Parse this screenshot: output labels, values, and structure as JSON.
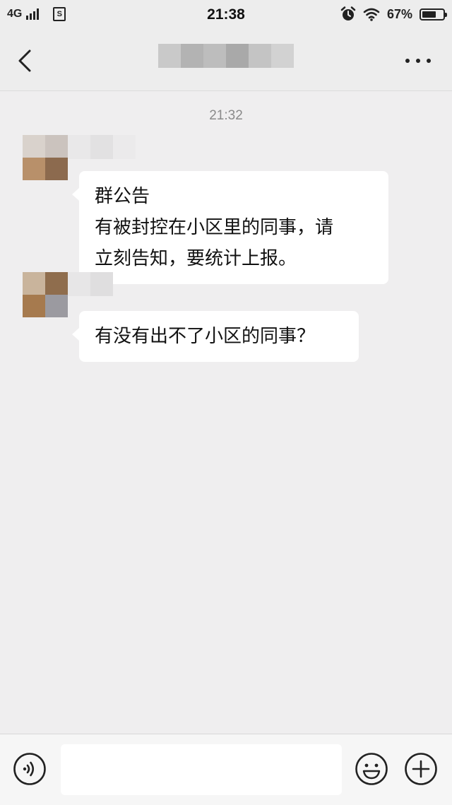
{
  "status_bar": {
    "network": "4G",
    "sim_label": "S",
    "time": "21:38",
    "battery_percent": "67%",
    "battery_level": 0.67,
    "icons": [
      "signal-icon",
      "sim-icon",
      "alarm-icon",
      "wifi-icon",
      "battery-icon"
    ]
  },
  "nav": {
    "back_icon": "chevron-left-icon",
    "title_blurred": true,
    "more_icon": "more-dots-icon"
  },
  "chat": {
    "timestamp": "21:32",
    "messages": [
      {
        "sender_blurred": true,
        "lines": [
          "群公告",
          "有被封控在小区里的同事，请",
          "立刻告知，要统计上报。"
        ]
      },
      {
        "sender_blurred": true,
        "lines": [
          "有没有出不了小区的同事？"
        ]
      }
    ]
  },
  "input_bar": {
    "voice_icon": "voice-icon",
    "input_value": "",
    "emoji_icon": "emoji-icon",
    "plus_icon": "plus-icon"
  },
  "colors": {
    "background": "#efeeef",
    "bubble": "#ffffff",
    "timestamp": "#8a8a8a",
    "bar": "#ededed"
  }
}
